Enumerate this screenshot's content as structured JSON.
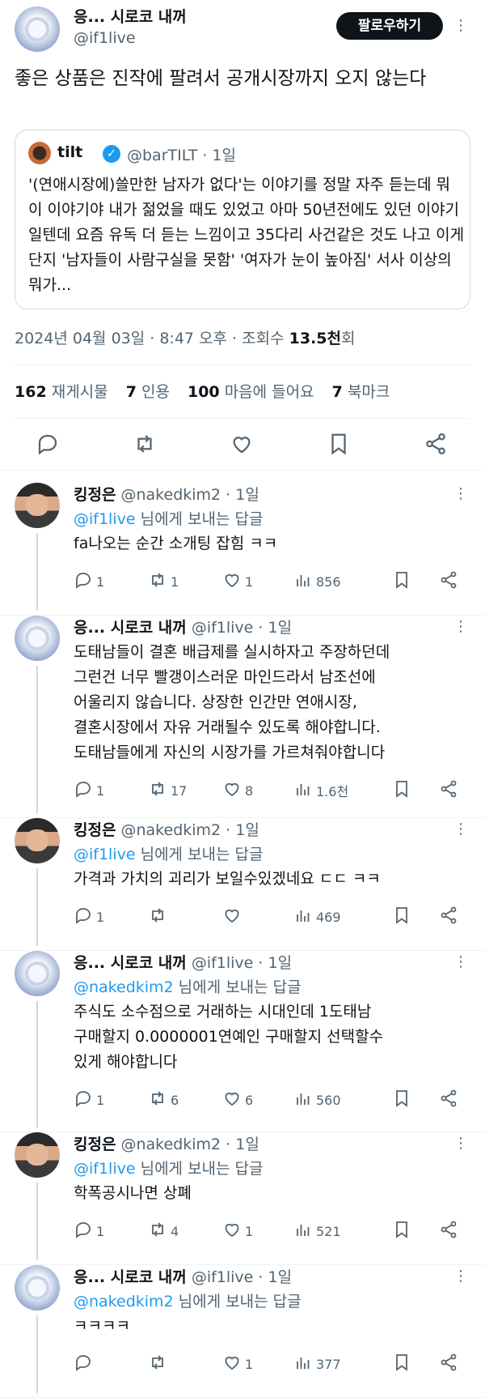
{
  "author": {
    "name": "응... 시로코 내꺼",
    "handle": "@if1live",
    "follow_label": "팔로우하기"
  },
  "post": {
    "text": "좋은 상품은 진작에 팔려서 공개시장까지 오지 않는다"
  },
  "quote": {
    "name": "tilt",
    "handle": "@barTILT · 1일",
    "text": "'(연애시장에)쓸만한 남자가 없다'는 이야기를 정말 자주 듣는데 뭐 이 이야기야 내가 젊었을 때도 있었고 아마 50년전에도 있던 이야기일텐데 요즘 유독 더 듣는 느낌이고 35다리 사건같은 것도 나고 이게 단지 '남자들이 사람구실을 못함' '여자가 눈이 높아짐' 서사 이상의 뭐가..."
  },
  "meta": {
    "datetime": "2024년 04월 03일 · 8:47 오후 · 조회수 ",
    "views": "13.5천",
    "views_suffix": "회"
  },
  "stats": {
    "retweets": "162",
    "retweets_label": "재게시물",
    "quotes": "7",
    "quotes_label": "인용",
    "likes": "100",
    "likes_label": "마음에 들어요",
    "bookmarks": "7",
    "bookmarks_label": "북마크"
  },
  "replies": [
    {
      "name": "킹정은",
      "handle": "@nakedkim2 · 1일",
      "to_mention": "@if1live",
      "to_suffix": " 님에게 보내는 답글",
      "text": "fa나오는 순간 소개팅 잡힘 ㅋㅋ",
      "replies": "1",
      "retweets": "1",
      "likes": "1",
      "views": "856",
      "avatar": "kim"
    },
    {
      "name": "응... 시로코 내꺼",
      "handle": "@if1live · 1일",
      "to_mention": "",
      "to_suffix": "",
      "text": "도태남들이 결혼 배급제를 실시하자고 주장하던데\n그런건 너무 빨갱이스러운 마인드라서 남조선에\n어울리지 않습니다. 상장한 인간만 연애시장,\n결혼시장에서 자유 거래될수 있도록 해야합니다.\n도태남들에게 자신의 시장가를 가르쳐줘야합니다",
      "replies": "1",
      "retweets": "17",
      "likes": "8",
      "views": "1.6천",
      "avatar": "anime"
    },
    {
      "name": "킹정은",
      "handle": "@nakedkim2 · 1일",
      "to_mention": "@if1live",
      "to_suffix": " 님에게 보내는 답글",
      "text": "가격과 가치의 괴리가 보일수있겠네요 ㄷㄷ ㅋㅋ",
      "replies": "1",
      "retweets": "",
      "likes": "",
      "views": "469",
      "avatar": "kim"
    },
    {
      "name": "응... 시로코 내꺼",
      "handle": "@if1live · 1일",
      "to_mention": "@nakedkim2",
      "to_suffix": " 님에게 보내는 답글",
      "text": "주식도 소수점으로 거래하는 시대인데 1도태남\n구매할지 0.0000001연예인 구매할지 선택할수\n있게 해야합니다",
      "replies": "1",
      "retweets": "6",
      "likes": "6",
      "views": "560",
      "avatar": "anime"
    },
    {
      "name": "킹정은",
      "handle": "@nakedkim2 · 1일",
      "to_mention": "@if1live",
      "to_suffix": " 님에게 보내는 답글",
      "text": "학폭공시나면 상폐",
      "replies": "1",
      "retweets": "4",
      "likes": "1",
      "views": "521",
      "avatar": "kim"
    },
    {
      "name": "응... 시로코 내꺼",
      "handle": "@if1live · 1일",
      "to_mention": "@nakedkim2",
      "to_suffix": " 님에게 보내는 답글",
      "text": "ㅋㅋㅋㅋ",
      "replies": "",
      "retweets": "",
      "likes": "1",
      "views": "377",
      "avatar": "anime"
    }
  ],
  "colors": {
    "accent": "#1d9bf0",
    "text": "#0f1419",
    "muted": "#536471",
    "border": "#cfd9de"
  },
  "icons": [
    "reply-icon",
    "retweet-icon",
    "like-icon",
    "bookmark-icon",
    "share-icon",
    "views-icon",
    "more-icon",
    "verified-icon"
  ]
}
